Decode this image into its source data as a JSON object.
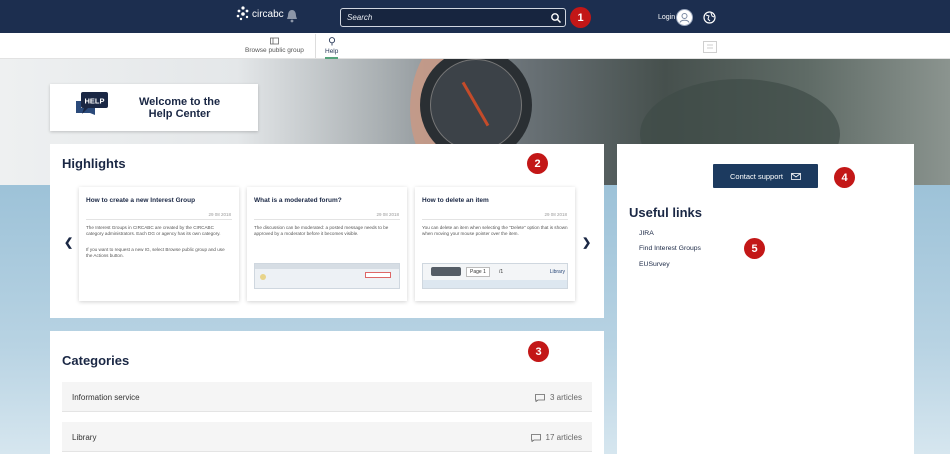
{
  "header": {
    "logo_text": "circabc",
    "search_placeholder": "Search",
    "login_label": "Login"
  },
  "nav": {
    "items": [
      {
        "label": "Browse public group",
        "icon": "library-icon"
      },
      {
        "label": "Help",
        "icon": "help-bulb-icon"
      }
    ]
  },
  "welcome": {
    "badge": "HELP",
    "line1": "Welcome to the",
    "line2": "Help Center"
  },
  "highlights": {
    "title": "Highlights",
    "cards": [
      {
        "title": "How to create a new Interest Group",
        "date": "29 08 2018",
        "body1": "The Interest Groups in CIRCABC are created by the CIRCABC category administrators. Each DG or agency has its own category.",
        "body2": "If you want to request a new IG, select Browse public group and use the Actions button."
      },
      {
        "title": "What is a moderated forum?",
        "date": "29 08 2018",
        "body1": "The discussion can be moderated: a posted message needs to be approved by a moderator before it becomes visible."
      },
      {
        "title": "How to delete an item",
        "date": "29 08 2018",
        "body1": "You can delete an item when selecting the \"Delete\" option that is shown when moving your mouse pointer over the item.",
        "shot_page": "Page 1",
        "shot_total": "/1",
        "shot_library": "Library"
      }
    ]
  },
  "categories": {
    "title": "Categories",
    "rows": [
      {
        "name": "Information service",
        "count": "3 articles"
      },
      {
        "name": "Library",
        "count": "17 articles"
      }
    ]
  },
  "sidebar": {
    "support_label": "Contact support",
    "useful_links_title": "Useful links",
    "links": [
      "JIRA",
      "Find Interest Groups",
      "EUSurvey"
    ]
  },
  "markers": [
    "1",
    "2",
    "3",
    "4",
    "5"
  ],
  "colors": {
    "topbar": "#1c2e4f",
    "marker": "#c31717",
    "primary_button": "#1c3a5f",
    "heading": "#1a2744"
  }
}
